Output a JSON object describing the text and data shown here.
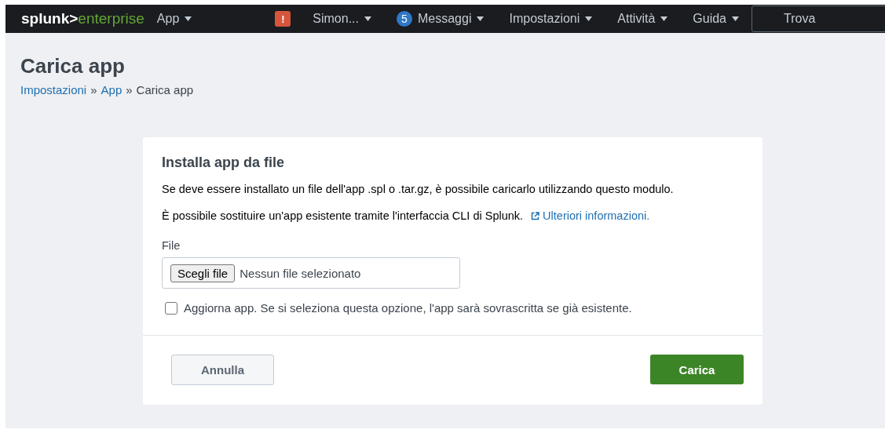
{
  "navbar": {
    "logo": {
      "brand": "splunk>",
      "product": "enterprise"
    },
    "menus": [
      {
        "kind": "menu",
        "label": "App"
      },
      {
        "kind": "alert",
        "badge": "!"
      },
      {
        "kind": "menu",
        "label": "Simon..."
      },
      {
        "kind": "count",
        "badge": "5",
        "label": "Messaggi"
      },
      {
        "kind": "menu",
        "label": "Impostazioni"
      },
      {
        "kind": "menu",
        "label": "Attività"
      },
      {
        "kind": "menu",
        "label": "Guida"
      }
    ],
    "search": {
      "placeholder": "Trova"
    }
  },
  "page": {
    "title": "Carica app",
    "breadcrumb": [
      {
        "label": "Impostazioni",
        "link": true
      },
      {
        "label": "App",
        "link": true
      },
      {
        "label": "Carica app",
        "link": false
      }
    ],
    "separator": "»"
  },
  "card": {
    "title": "Installa app da file",
    "description": "Se deve essere installato un file dell'app .spl o .tar.gz, è possibile caricarlo utilizzando questo modulo.",
    "note": "È possibile sostituire un'app esistente tramite l'interfaccia CLI di Splunk.",
    "link": "Ulteriori informazioni.",
    "file_label": "File",
    "file_button": "Scegli file",
    "file_status": "Nessun file selezionato",
    "upgrade": {
      "label": "Aggiorna app. Se si seleziona questa opzione, l'app sarà sovrascritta se già esistente.",
      "checked": false
    },
    "cancel": "Annulla",
    "submit": "Carica"
  }
}
